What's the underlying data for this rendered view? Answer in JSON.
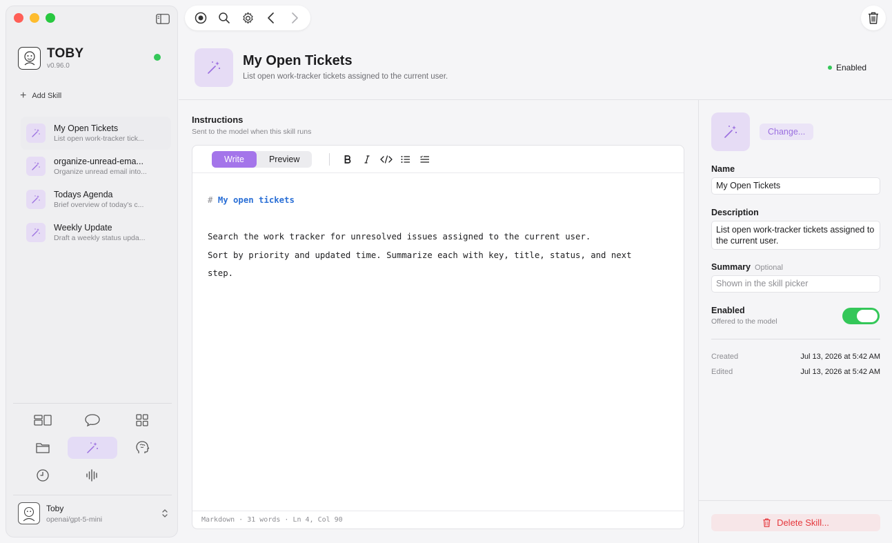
{
  "app": {
    "name": "TOBY",
    "version": "v0.96.0"
  },
  "sidebar": {
    "add_skill_label": "Add Skill",
    "skills": [
      {
        "name": "My Open Tickets",
        "desc": "List open work-tracker tick..."
      },
      {
        "name": "organize-unread-ema...",
        "desc": "Organize unread email into..."
      },
      {
        "name": "Todays Agenda",
        "desc": "Brief overview of today's c..."
      },
      {
        "name": "Weekly Update",
        "desc": "Draft a weekly status upda..."
      }
    ],
    "nav_icons": [
      "layout-icon",
      "chat-icon",
      "grid-icon",
      "folder-icon",
      "magic-wand-icon",
      "brain-head-icon",
      "clock-icon",
      "waveform-icon"
    ],
    "user": {
      "name": "Toby",
      "model": "openai/gpt-5-mini"
    }
  },
  "header": {
    "title": "My Open Tickets",
    "subtitle": "List open work-tracker tickets assigned to the current user.",
    "status": "Enabled"
  },
  "editor": {
    "section_title": "Instructions",
    "section_sub": "Sent to the model when this skill runs",
    "tabs": [
      "Write",
      "Preview"
    ],
    "active_tab": "Write",
    "heading_hash": "#",
    "heading_text": "My open tickets",
    "line1": "Search the work tracker for unresolved issues assigned to the current user.",
    "line2": "Sort by priority and updated time. Summarize each with key, title, status, and next",
    "line3": "step.",
    "footer": "Markdown · 31 words · Ln 4, Col 90"
  },
  "details": {
    "change_label": "Change...",
    "name_label": "Name",
    "name_value": "My Open Tickets",
    "desc_label": "Description",
    "desc_value": "List open work-tracker tickets assigned to the current user.",
    "summary_label": "Summary",
    "summary_optional": "Optional",
    "summary_placeholder": "Shown in the skill picker",
    "enabled_label": "Enabled",
    "enabled_sub": "Offered to the model",
    "enabled": true,
    "created_label": "Created",
    "created_value": "Jul 13, 2026 at 5:42 AM",
    "edited_label": "Edited",
    "edited_value": "Jul 13, 2026 at 5:42 AM",
    "delete_label": "Delete Skill..."
  },
  "colors": {
    "accent": "#a475ea",
    "accent_soft": "#e6dcf5",
    "success": "#34c759",
    "danger": "#e5363b"
  }
}
